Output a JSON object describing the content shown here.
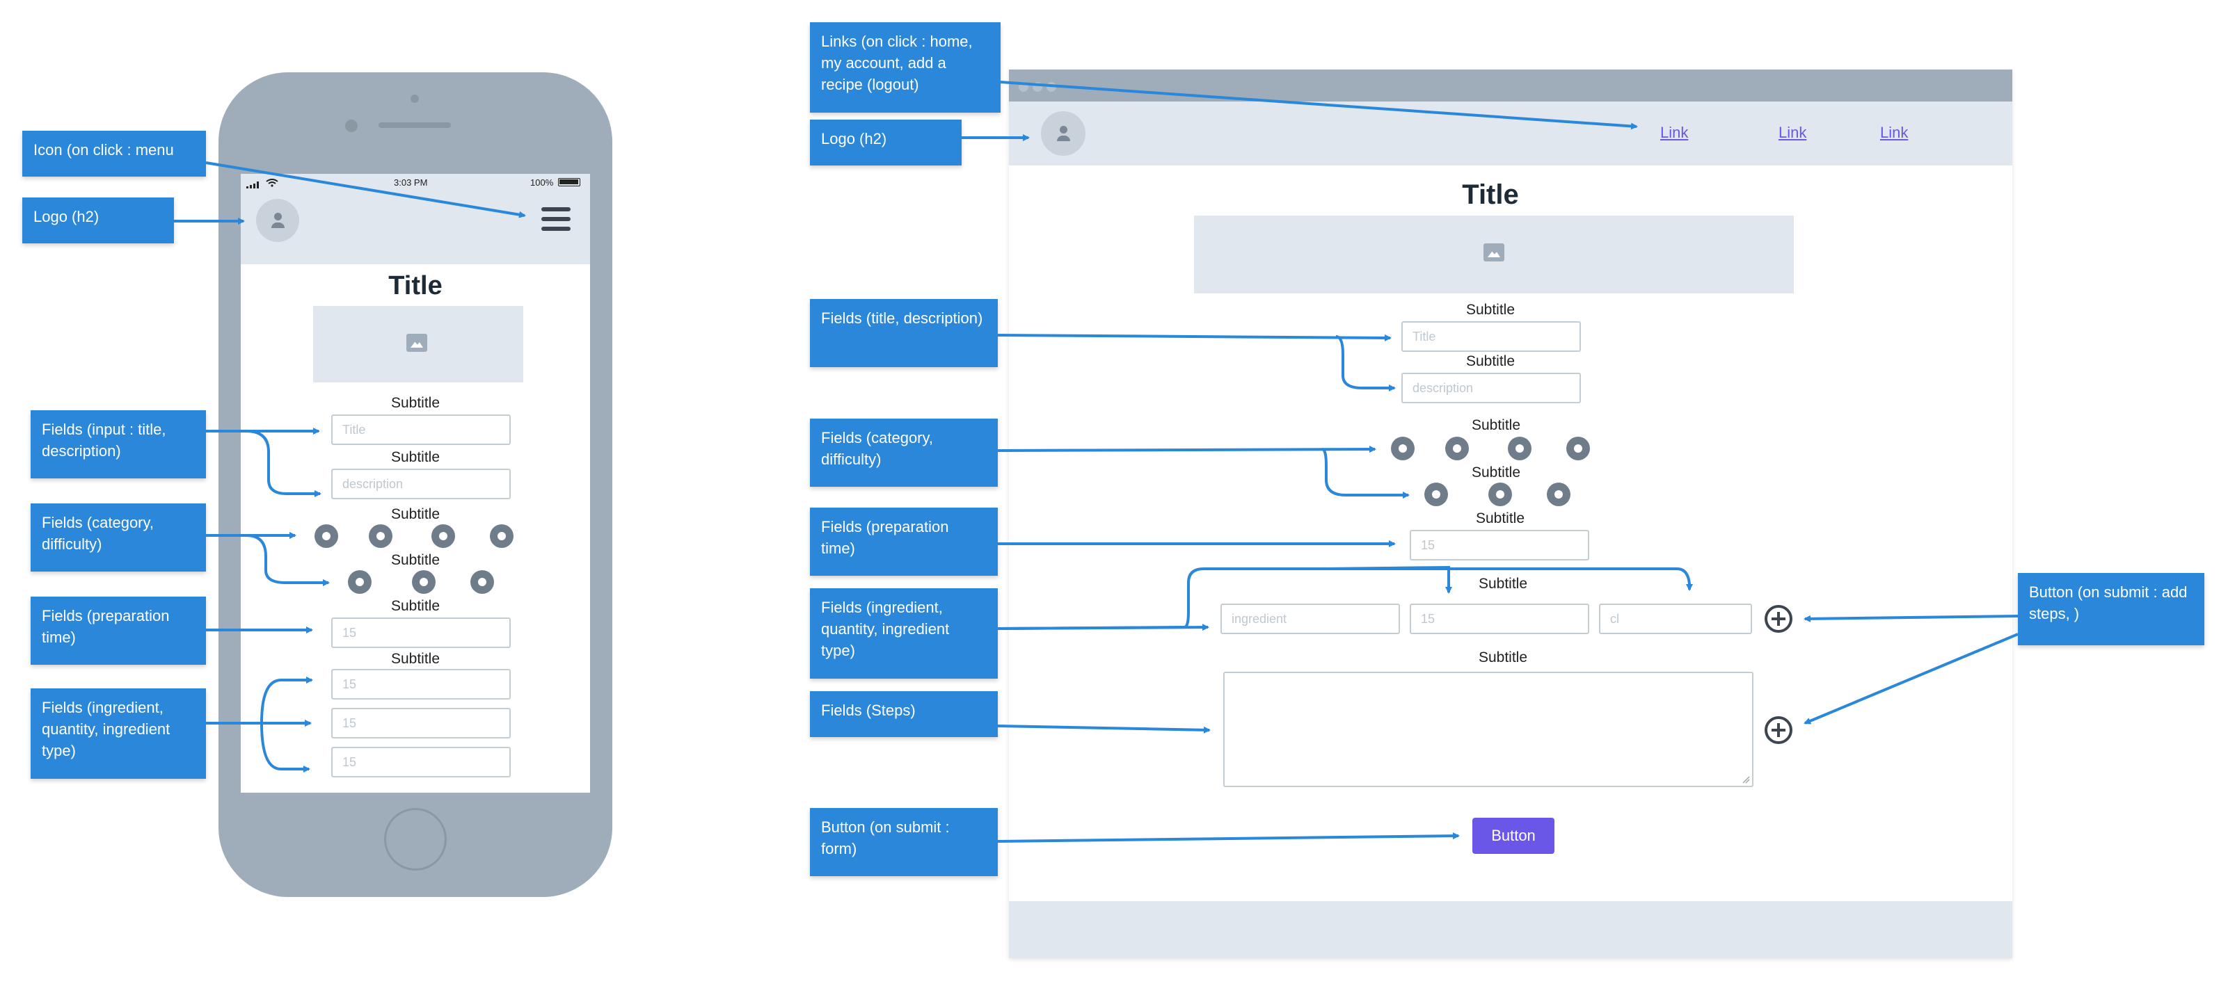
{
  "notes": {
    "mobile": [
      "Icon (on click : menu",
      "Logo (h2)",
      "Fields (input : title, description)",
      "Fields (category, difficulty)",
      "Fields (preparation time)",
      "Fields (ingredient, quantity, ingredient type)"
    ],
    "desktop": [
      "Links (on click : home, my account, add a recipe (logout)",
      "Logo (h2)",
      "Fields (title, description)",
      "Fields (category, difficulty)",
      "Fields (preparation time)",
      "Fields (ingredient, quantity, ingredient type)",
      "Fields (Steps)",
      "Button (on submit : form)",
      "Button (on submit : add steps, )"
    ]
  },
  "mobile": {
    "status": {
      "time": "3:03 PM",
      "battery": "100%"
    },
    "title": "Title",
    "subtitle": "Subtitle",
    "placeholders": {
      "title": "Title",
      "description": "description",
      "number": "15"
    }
  },
  "desktop": {
    "nav_links": [
      "Link",
      "Link",
      "Link"
    ],
    "title": "Title",
    "subtitle": "Subtitle",
    "placeholders": {
      "title": "Title",
      "description": "description",
      "prep_time": "15",
      "ingredient": "ingredient",
      "quantity": "15",
      "type": "cl"
    },
    "button_label": "Button"
  },
  "colors": {
    "annotation": "#2b87d9",
    "accent": "#6a57e8",
    "frame": "#9eadb9",
    "header": "#e1e7ee"
  }
}
